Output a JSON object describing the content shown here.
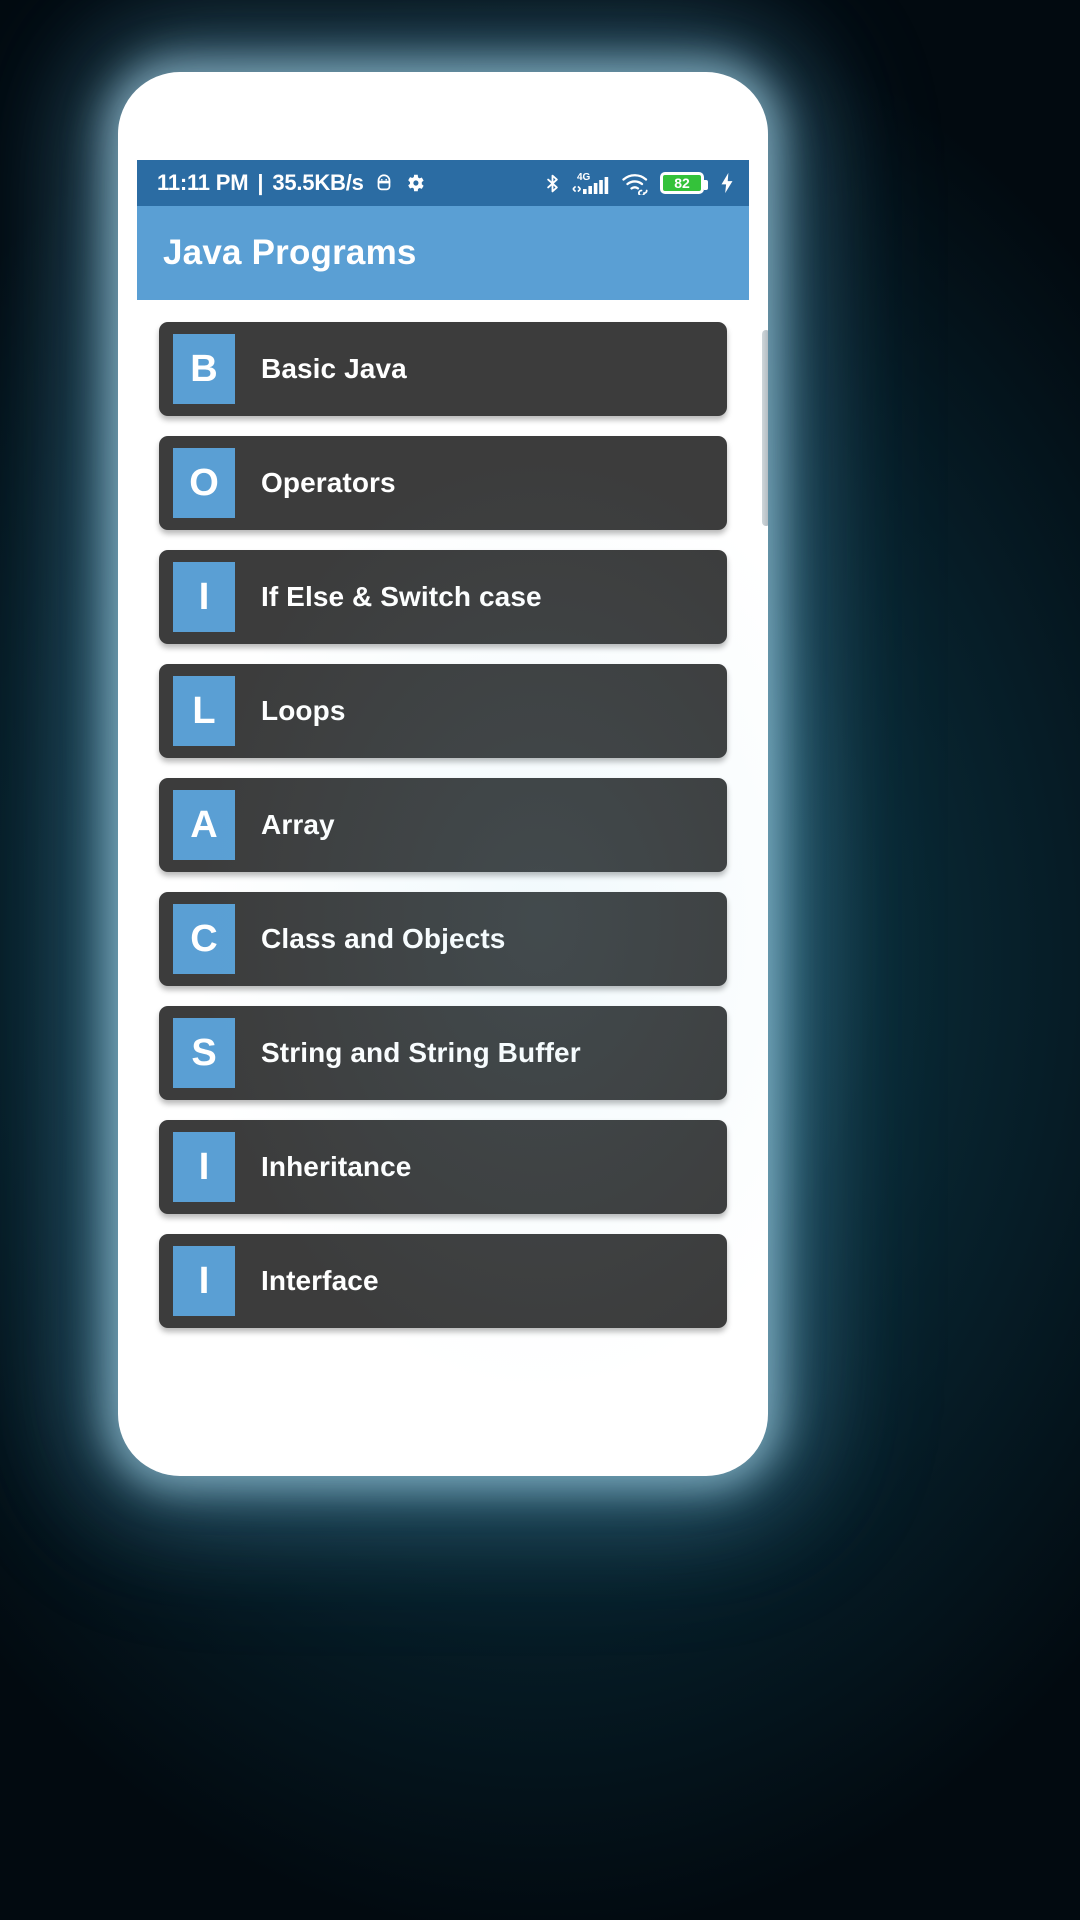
{
  "colors": {
    "statusbar_bg": "#2b6ca3",
    "appbar_bg": "#5a9fd4",
    "card_bg": "#3c3c3c",
    "badge_bg": "#5a9fd4",
    "battery_green": "#34c23a",
    "text_white": "#ffffff",
    "backdrop_dark": "#061c26"
  },
  "statusbar": {
    "time": "11:11 PM",
    "separator": "|",
    "network_speed": "35.5KB/s",
    "icons_left": [
      "android-head-icon",
      "gear-icon"
    ],
    "icons_right": [
      "bluetooth-icon",
      "4g-signal-icon",
      "wifi-icon",
      "battery-icon",
      "charging-bolt-icon"
    ],
    "network_type": "4G",
    "battery_percent": "82"
  },
  "appbar": {
    "title": "Java Programs"
  },
  "list": {
    "items": [
      {
        "letter": "B",
        "label": "Basic Java"
      },
      {
        "letter": "O",
        "label": "Operators"
      },
      {
        "letter": "I",
        "label": "If Else & Switch case"
      },
      {
        "letter": "L",
        "label": "Loops"
      },
      {
        "letter": "A",
        "label": "Array"
      },
      {
        "letter": "C",
        "label": "Class and Objects"
      },
      {
        "letter": "S",
        "label": "String and String Buffer"
      },
      {
        "letter": "I",
        "label": "Inheritance"
      },
      {
        "letter": "I",
        "label": "Interface"
      }
    ]
  }
}
